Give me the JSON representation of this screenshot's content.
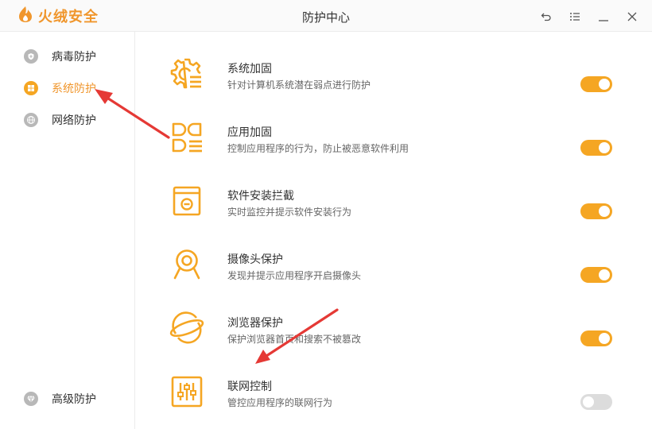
{
  "app": {
    "logo_text": "火绒安全",
    "window_title": "防护中心"
  },
  "window_controls": [
    "back-icon",
    "menu-icon",
    "minimize-icon",
    "close-icon"
  ],
  "sidebar": {
    "items": [
      {
        "label": "病毒防护",
        "icon": "virus-shield-icon",
        "active": false
      },
      {
        "label": "系统防护",
        "icon": "windows-icon",
        "active": true
      },
      {
        "label": "网络防护",
        "icon": "globe-icon",
        "active": false
      }
    ],
    "bottom_item": {
      "label": "高级防护",
      "icon": "gem-icon"
    }
  },
  "protections": [
    {
      "title": "系统加固",
      "desc": "针对计算机系统潜在弱点进行防护",
      "icon": "gear-list-icon",
      "enabled": true
    },
    {
      "title": "应用加固",
      "desc": "控制应用程序的行为，防止被恶意软件利用",
      "icon": "apps-icon",
      "enabled": true
    },
    {
      "title": "软件安装拦截",
      "desc": "实时监控并提示软件安装行为",
      "icon": "install-block-icon",
      "enabled": true
    },
    {
      "title": "摄像头保护",
      "desc": "发现并提示应用程序开启摄像头",
      "icon": "webcam-icon",
      "enabled": true
    },
    {
      "title": "浏览器保护",
      "desc": "保护浏览器首页和搜索不被篡改",
      "icon": "planet-icon",
      "enabled": true
    },
    {
      "title": "联网控制",
      "desc": "管控应用程序的联网行为",
      "icon": "network-control-icon",
      "enabled": false
    }
  ],
  "colors": {
    "accent": "#f5a623",
    "brand": "#f0962c",
    "toggle_off": "#dcdcdc",
    "arrow": "#e53935"
  }
}
